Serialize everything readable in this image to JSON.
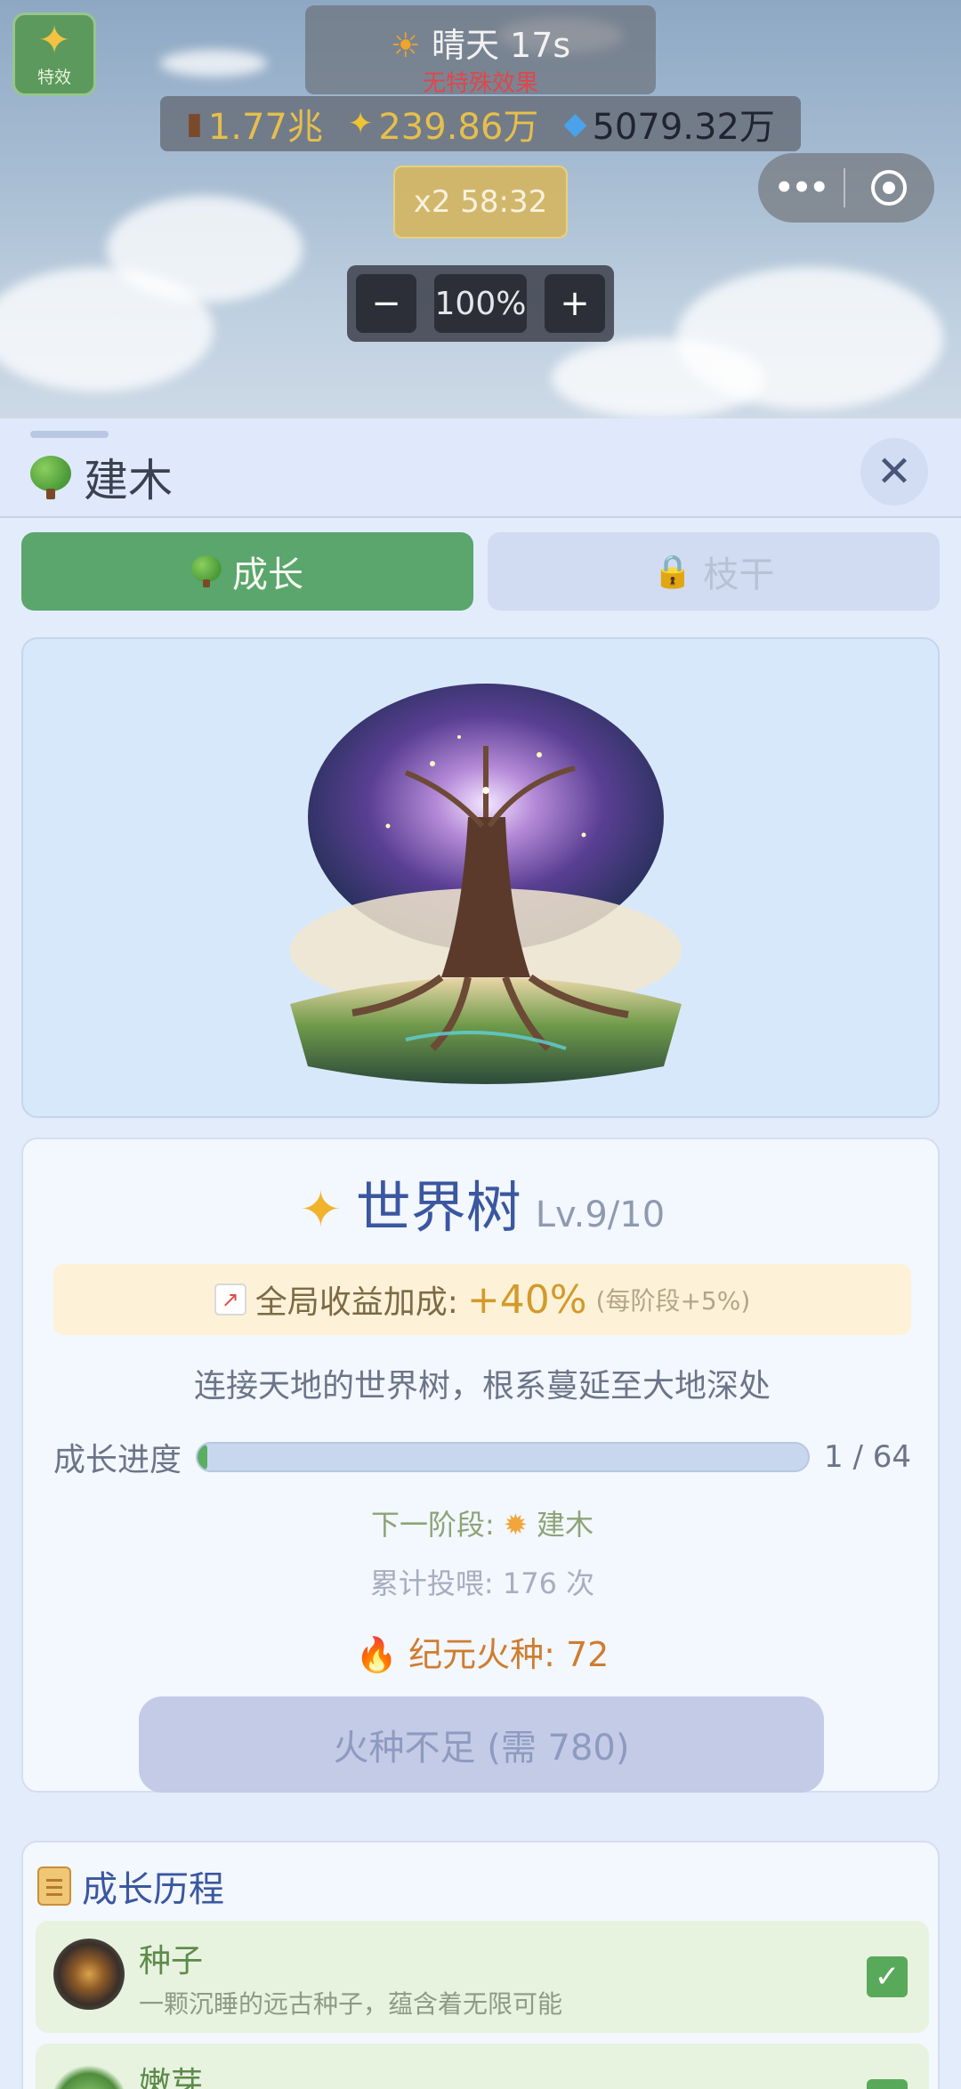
{
  "header": {
    "effects_label": "特效",
    "weather_label": "晴天 17s",
    "weather_effect": "无特殊效果",
    "resources": [
      {
        "icon": "wood-icon",
        "value": "1.77兆"
      },
      {
        "icon": "sparkle-icon",
        "value": "239.86万"
      },
      {
        "icon": "diamond-icon",
        "value": "5079.32万"
      }
    ],
    "boost": "x2 58:32",
    "zoom": {
      "minus": "−",
      "value": "100%",
      "plus": "+"
    }
  },
  "panel": {
    "title": "建木",
    "close": "✕",
    "tabs": [
      {
        "label": "成长",
        "active": true
      },
      {
        "label": "枝干",
        "active": false,
        "locked": true
      }
    ],
    "tree": {
      "name": "世界树",
      "level": "Lv.9/10",
      "bonus_label": "全局收益加成:",
      "bonus_value": "+40%",
      "bonus_note": "(每阶段+5%)",
      "description": "连接天地的世界树，根系蔓延至大地深处",
      "progress_label": "成长进度",
      "progress_text": "1 / 64",
      "progress_fraction": 0.0156,
      "next_stage": "下一阶段:",
      "next_stage_name": "建木",
      "feed_count": "累计投喂: 176 次",
      "ember": "纪元火种: 72",
      "action_button": "火种不足 (需 780)"
    },
    "history": {
      "title": "成长历程",
      "stages": [
        {
          "name": "种子",
          "description": "一颗沉睡的远古种子，蕴含着无限可能",
          "done": true
        },
        {
          "name": "嫩芽",
          "description": "",
          "done": true
        }
      ]
    }
  },
  "colors": {
    "tab_active": "#5aa66c",
    "accent_gold": "#d39a2a",
    "title_blue": "#3a57a0",
    "progress_fill": "#5aae62"
  }
}
